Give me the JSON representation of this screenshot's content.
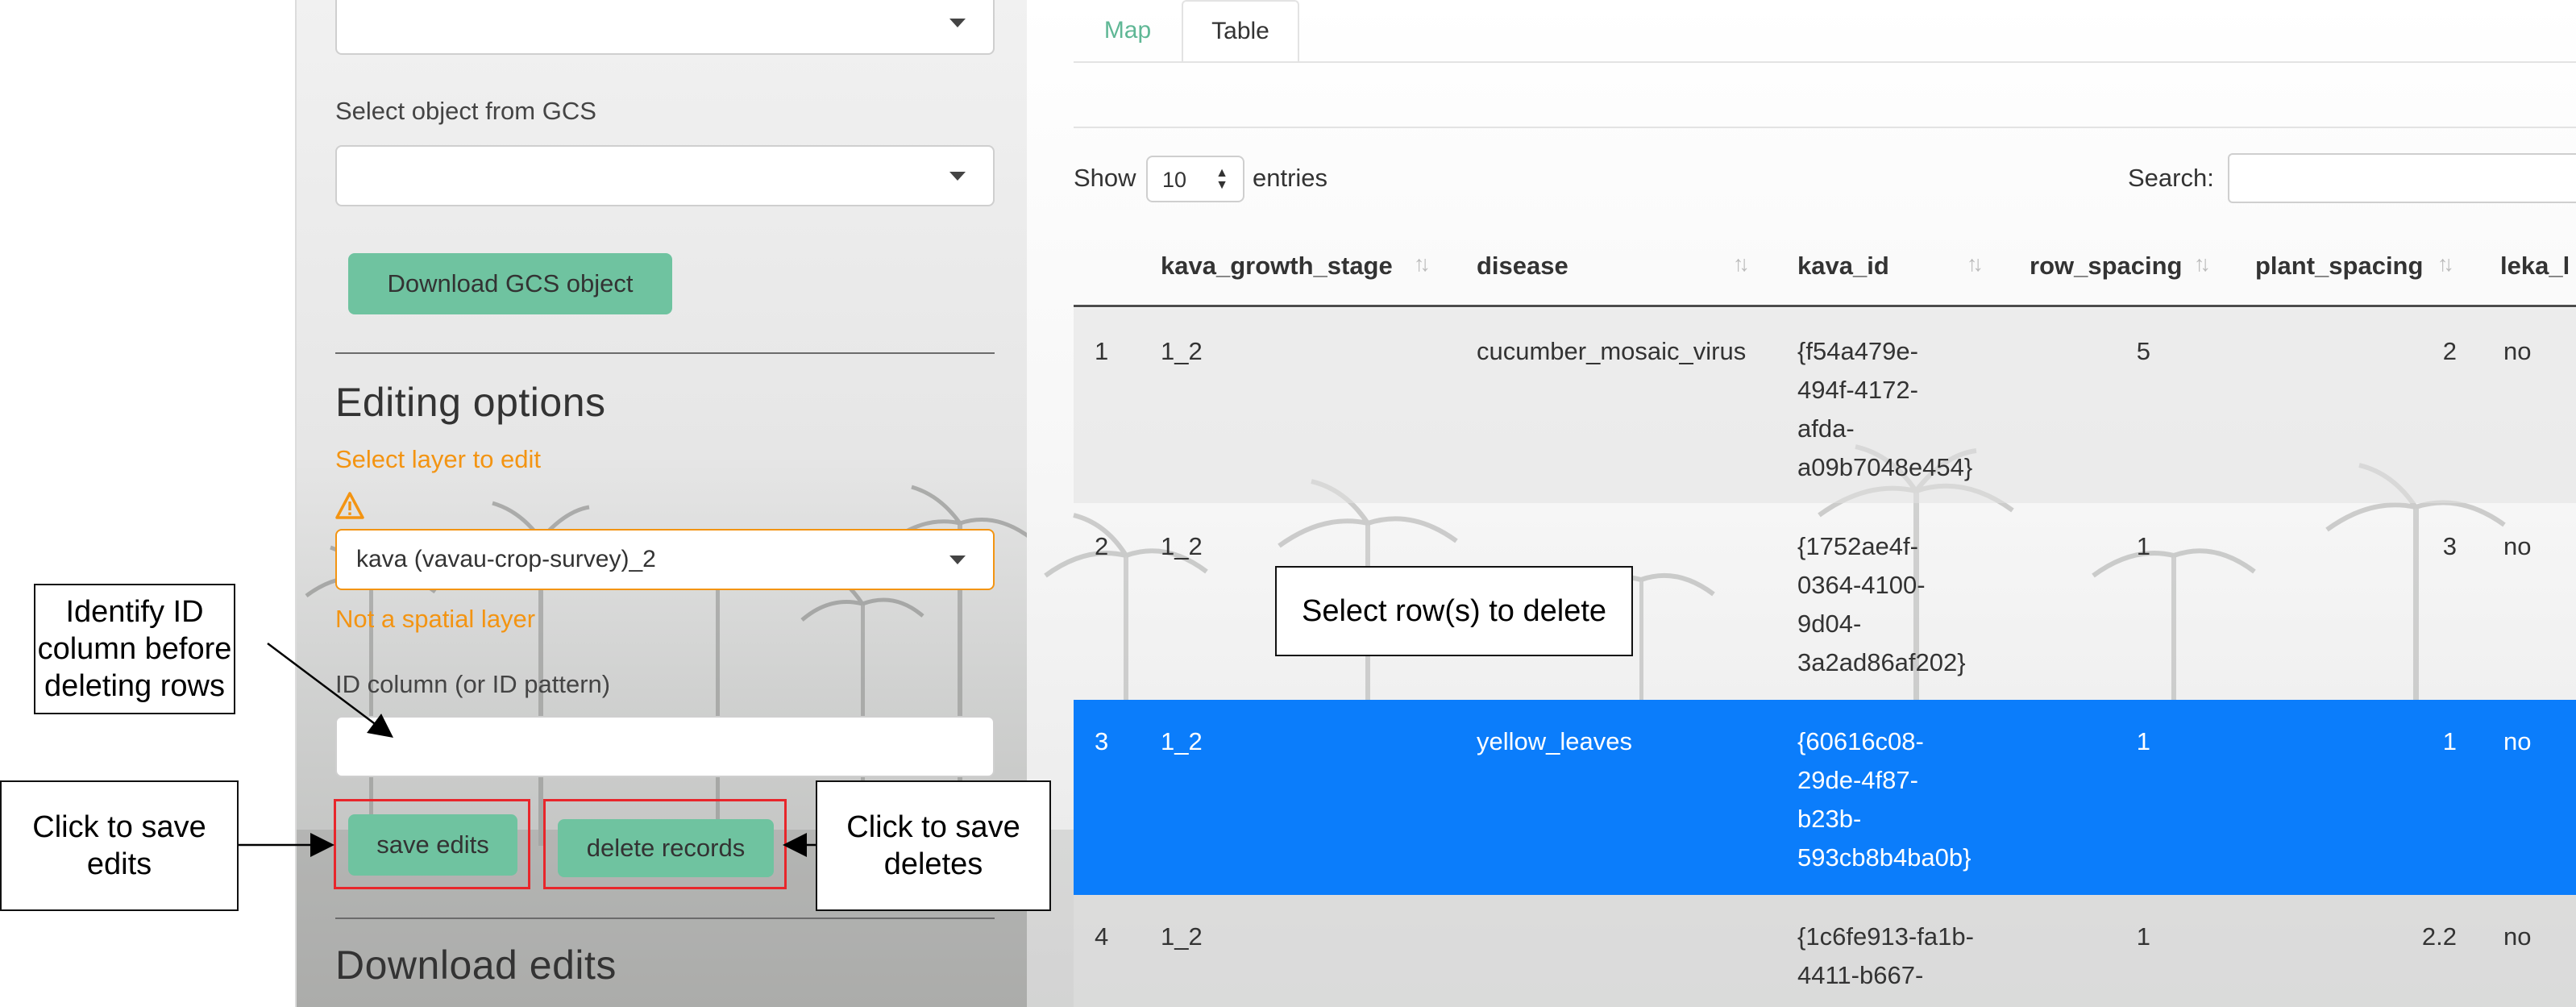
{
  "sidebar": {
    "gcs_label": "Select object from GCS",
    "download_gcs_button": "Download GCS object",
    "editing_heading": "Editing options",
    "select_layer_label": "Select layer to edit",
    "warning_icon": "warning-triangle-icon",
    "layer_value": "kava (vavau-crop-survey)_2",
    "not_spatial": "Not a spatial layer",
    "id_column_label": "ID column (or ID pattern)",
    "id_column_value": "",
    "save_button": "save edits",
    "delete_button": "delete records",
    "download_heading": "Download edits",
    "accent_color": "#6fc3a0",
    "warning_color": "#f39412"
  },
  "main": {
    "tabs": [
      {
        "label": "Map",
        "active": false
      },
      {
        "label": "Table",
        "active": true
      }
    ],
    "show_label": "Show",
    "page_length": "10",
    "entries_label": "entries",
    "search_label": "Search:",
    "search_value": "",
    "columns": [
      "kava_growth_stage",
      "disease",
      "kava_id",
      "row_spacing",
      "plant_spacing",
      "leka_l"
    ],
    "rows": [
      {
        "index": "1",
        "stage": "1_2",
        "disease": "cucumber_mosaic_virus",
        "kava_id": [
          "{f54a479e-",
          "494f-4172-",
          "afda-",
          "a09b7048e454}"
        ],
        "row_spacing": "5",
        "plant_spacing": "2",
        "leka": "no",
        "selected": false
      },
      {
        "index": "2",
        "stage": "1_2",
        "disease": "",
        "kava_id": [
          "{1752ae4f-",
          "0364-4100-",
          "9d04-",
          "3a2ad86af202}"
        ],
        "row_spacing": "1",
        "plant_spacing": "3",
        "leka": "no",
        "selected": false
      },
      {
        "index": "3",
        "stage": "1_2",
        "disease": "yellow_leaves",
        "kava_id": [
          "{60616c08-",
          "29de-4f87-",
          "b23b-",
          "593cb8b4ba0b}"
        ],
        "row_spacing": "1",
        "plant_spacing": "1",
        "leka": "no",
        "selected": true
      },
      {
        "index": "4",
        "stage": "1_2",
        "disease": "",
        "kava_id": [
          "{1c6fe913-fa1b-",
          "4411-b667-"
        ],
        "row_spacing": "1",
        "plant_spacing": "2.2",
        "leka": "no",
        "selected": false
      }
    ],
    "selected_color": "#0b7dfb"
  },
  "annotations": {
    "identify_id": [
      "Identify ID",
      "column before",
      "deleting rows"
    ],
    "save_edits": [
      "Click to save",
      "edits"
    ],
    "save_deletes": [
      "Click to save",
      "deletes"
    ],
    "select_rows": "Select row(s) to delete"
  }
}
